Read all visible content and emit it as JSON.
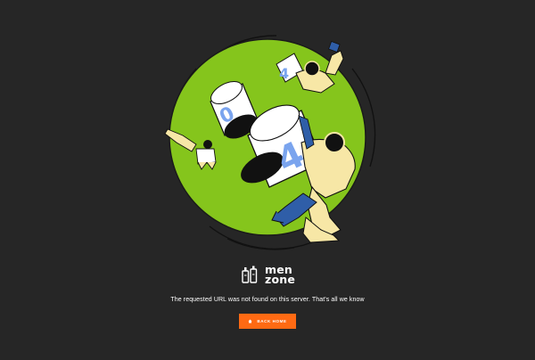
{
  "logo": {
    "line1": "men",
    "line2": "zone",
    "icon": "bottles-logo-icon"
  },
  "message": "The requested URL was not found on this server. That's all we know",
  "back_button": {
    "label": "Back home",
    "icon": "home-icon",
    "color": "#ff6a13"
  },
  "illustration": {
    "digits": [
      "4",
      "0",
      "4"
    ],
    "planet_color": "#85c51c",
    "background": "#262626"
  }
}
